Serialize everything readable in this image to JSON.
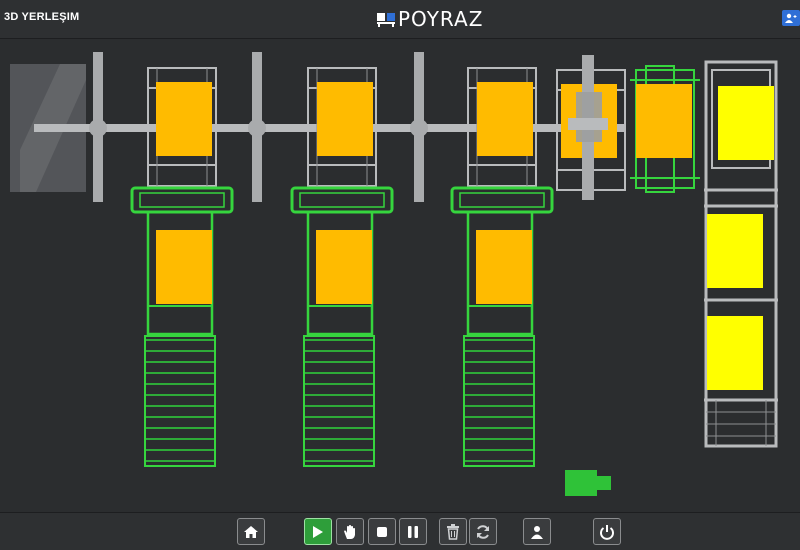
{
  "header": {
    "title": "3D YERLEŞIM",
    "logo_text": "POYRAZ",
    "user_button_icon": "user-add-icon"
  },
  "colors": {
    "background": "#2b2d2f",
    "conveyor_green": "#36d53e",
    "rail_gray": "#b9bbbd",
    "pallet_orange": "#ffbb00",
    "pallet_yellow": "#ffff00",
    "accent_blue": "#2f6fd6",
    "play_green": "#2e9e3a"
  },
  "toolbar": {
    "buttons": [
      {
        "name": "home-button",
        "icon": "home-icon"
      },
      {
        "name": "play-button",
        "icon": "play-icon"
      },
      {
        "name": "manual-button",
        "icon": "hand-icon"
      },
      {
        "name": "stop-button",
        "icon": "stop-icon"
      },
      {
        "name": "pause-button",
        "icon": "pause-icon"
      },
      {
        "name": "delete-button",
        "icon": "trash-icon"
      },
      {
        "name": "reset-button",
        "icon": "refresh-icon"
      },
      {
        "name": "user-button",
        "icon": "person-icon"
      },
      {
        "name": "power-button",
        "icon": "power-icon"
      }
    ]
  }
}
